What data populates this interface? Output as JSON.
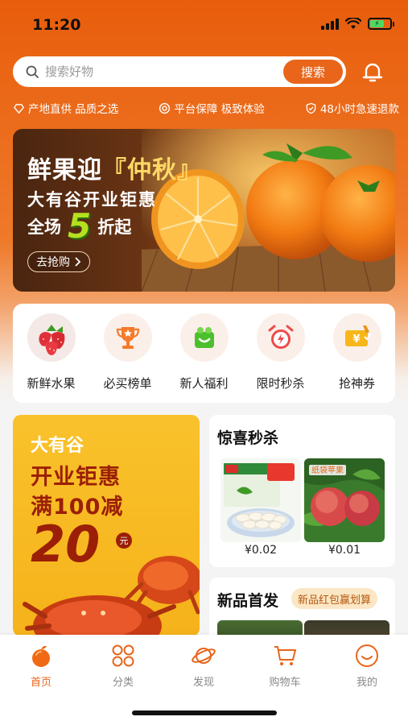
{
  "status_bar": {
    "time": "11:20"
  },
  "search": {
    "placeholder": "搜索好物",
    "button_label": "搜索"
  },
  "promises": [
    {
      "label": "产地直供 品质之选",
      "icon": "heart-diamond-icon"
    },
    {
      "label": "平台保障 极致体验",
      "icon": "shield-target-icon"
    },
    {
      "label": "48小时急速退款",
      "icon": "shield-check-icon"
    }
  ],
  "banner": {
    "title_prefix": "鲜果迎",
    "title_highlight": "『仲秋』",
    "subtitle": "大有谷开业钜惠",
    "deal_prefix": "全场",
    "deal_number": "5",
    "deal_suffix": "折起",
    "button_label": "去抢购"
  },
  "categories": [
    {
      "label": "新鲜水果",
      "icon": "strawberry-icon"
    },
    {
      "label": "必买榜单",
      "icon": "trophy-icon"
    },
    {
      "label": "新人福利",
      "icon": "gift-bag-icon"
    },
    {
      "label": "限时秒杀",
      "icon": "alarm-clock-icon"
    },
    {
      "label": "抢神券",
      "icon": "coupon-icon"
    }
  ],
  "promo": {
    "brand": "大有谷",
    "line1": "开业钜惠",
    "line2": "满100减",
    "amount": "20",
    "unit": "元"
  },
  "flash_sale": {
    "title": "惊喜秒杀",
    "products": [
      {
        "price": "¥0.02",
        "image": "dumplings-image"
      },
      {
        "price": "¥0.01",
        "image": "apples-image",
        "tag": "纸袋苹果"
      }
    ]
  },
  "new_arrivals": {
    "title": "新品首发",
    "badge": "新品红包赢划算"
  },
  "tab_bar": [
    {
      "label": "首页",
      "icon": "home-orange-icon",
      "active": true
    },
    {
      "label": "分类",
      "icon": "category-grid-icon",
      "active": false
    },
    {
      "label": "发现",
      "icon": "planet-icon",
      "active": false
    },
    {
      "label": "购物车",
      "icon": "cart-icon",
      "active": false
    },
    {
      "label": "我的",
      "icon": "smile-face-icon",
      "active": false
    }
  ],
  "colors": {
    "accent": "#e8651a",
    "promo_bg": "#f9c22c",
    "promo_text": "#9b1f07"
  }
}
